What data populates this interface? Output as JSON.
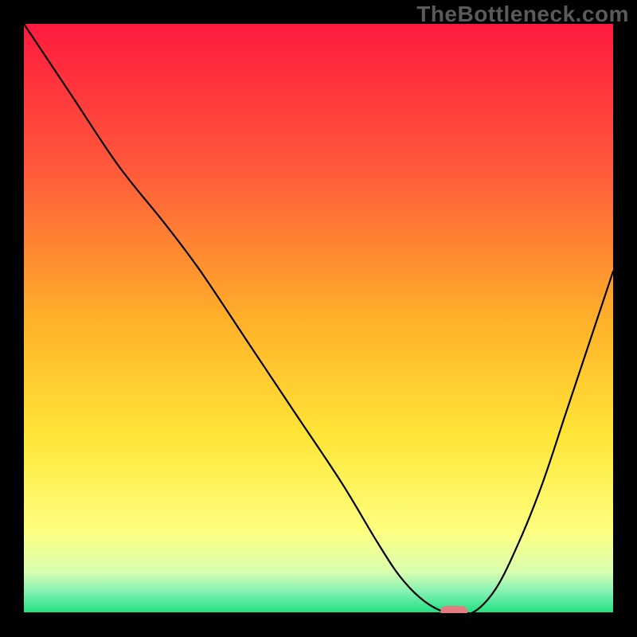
{
  "watermark": "TheBottleneck.com",
  "chart_data": {
    "type": "line",
    "title": "",
    "xlabel": "",
    "ylabel": "",
    "xlim": [
      0,
      100
    ],
    "ylim": [
      0,
      100
    ],
    "grid": false,
    "legend": false,
    "background": {
      "type": "vertical_gradient",
      "stops": [
        {
          "pos": 0.0,
          "color": "#ff1a3f"
        },
        {
          "pos": 0.25,
          "color": "#ff5a3a"
        },
        {
          "pos": 0.5,
          "color": "#ffb02a"
        },
        {
          "pos": 0.7,
          "color": "#ffe637"
        },
        {
          "pos": 0.86,
          "color": "#feff80"
        },
        {
          "pos": 0.93,
          "color": "#d9ffb0"
        },
        {
          "pos": 0.965,
          "color": "#7ff0b2"
        },
        {
          "pos": 1.0,
          "color": "#1fe07f"
        }
      ]
    },
    "series": [
      {
        "name": "bottleneck-curve",
        "x": [
          0,
          8,
          16,
          24,
          30,
          38,
          46,
          54,
          60,
          64,
          68,
          72,
          76,
          80,
          84,
          88,
          92,
          96,
          100
        ],
        "y": [
          100,
          88,
          76,
          66,
          58,
          46,
          34,
          22,
          12,
          6,
          2,
          0,
          0,
          4,
          12,
          22,
          34,
          46,
          58
        ]
      }
    ],
    "marker": {
      "name": "optimal-point",
      "x": 73,
      "y": 0,
      "color": "#e37b82",
      "shape": "rounded-bar"
    }
  }
}
